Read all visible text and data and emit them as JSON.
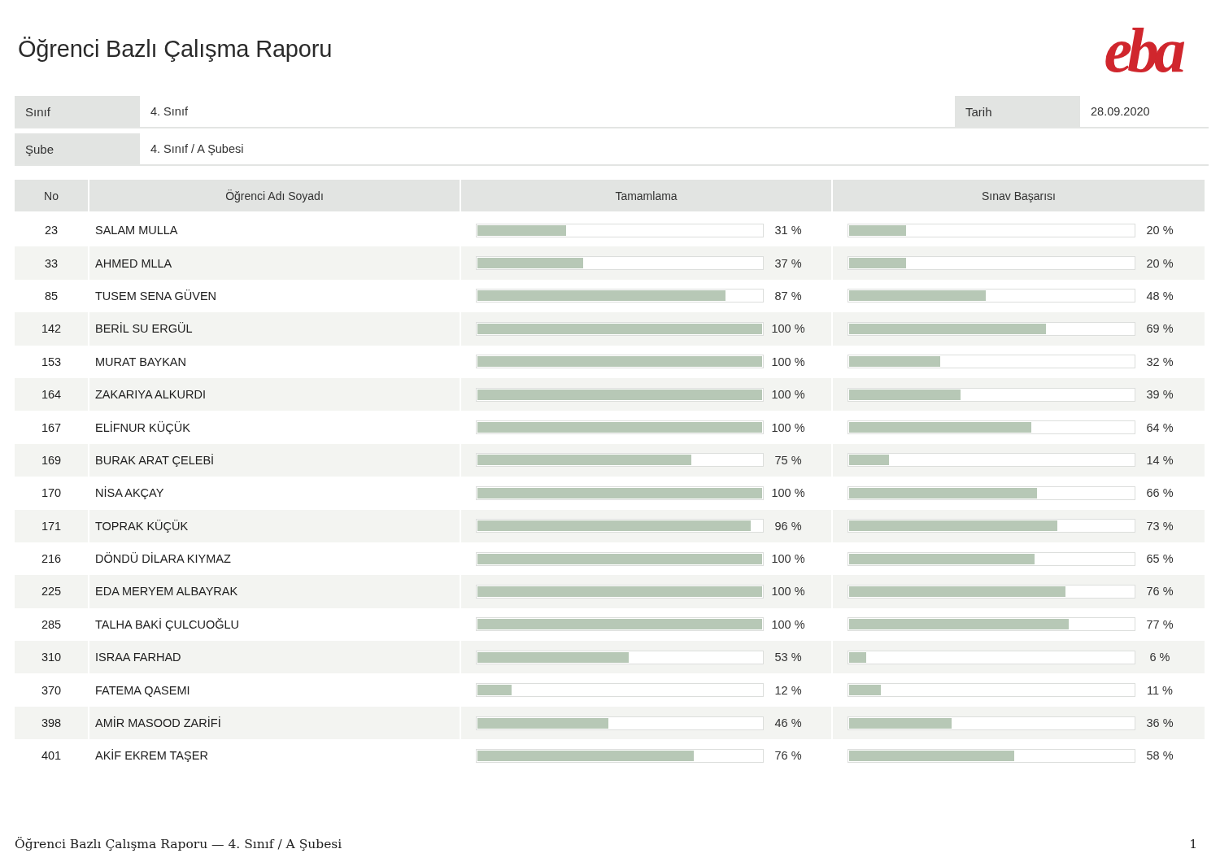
{
  "title": "Öğrenci Bazlı Çalışma Raporu",
  "logo": "eba",
  "info": [
    {
      "label": "Sınıf",
      "value": "4. Sınıf",
      "extra_label": "Tarih",
      "extra_value": "28.09.2020"
    },
    {
      "label": "Şube",
      "value": "4. Sınıf / A Şubesi"
    }
  ],
  "table": {
    "columns": [
      "No",
      "Öğrenci Adı Soyadı",
      "Tamamlama",
      "Sınav Başarısı"
    ],
    "rows": [
      {
        "no": "23",
        "name": "SALAM MULLA",
        "completion": {
          "level": 0.31,
          "reading": "31 %"
        },
        "exam": {
          "level": 0.2,
          "reading": "20 %"
        }
      },
      {
        "no": "33",
        "name": "AHMED MLLA",
        "completion": {
          "level": 0.37,
          "reading": "37 %"
        },
        "exam": {
          "level": 0.2,
          "reading": "20 %"
        }
      },
      {
        "no": "85",
        "name": "TUSEM SENA GÜVEN",
        "completion": {
          "level": 0.87,
          "reading": "87 %"
        },
        "exam": {
          "level": 0.48,
          "reading": "48 %"
        }
      },
      {
        "no": "142",
        "name": "BERİL SU ERGÜL",
        "completion": {
          "level": 1,
          "reading": "100 %"
        },
        "exam": {
          "level": 0.69,
          "reading": "69 %"
        }
      },
      {
        "no": "153",
        "name": "MURAT BAYKAN",
        "completion": {
          "level": 1,
          "reading": "100 %"
        },
        "exam": {
          "level": 0.32,
          "reading": "32 %"
        }
      },
      {
        "no": "164",
        "name": "ZAKARIYA ALKURDI",
        "completion": {
          "level": 1,
          "reading": "100 %"
        },
        "exam": {
          "level": 0.39,
          "reading": "39 %"
        }
      },
      {
        "no": "167",
        "name": "ELİFNUR KÜÇÜK",
        "completion": {
          "level": 1,
          "reading": "100 %"
        },
        "exam": {
          "level": 0.64,
          "reading": "64 %"
        }
      },
      {
        "no": "169",
        "name": "BURAK ARAT ÇELEBİ",
        "completion": {
          "level": 0.75,
          "reading": "75 %"
        },
        "exam": {
          "level": 0.14,
          "reading": "14 %"
        }
      },
      {
        "no": "170",
        "name": "NİSA AKÇAY",
        "completion": {
          "level": 1,
          "reading": "100 %"
        },
        "exam": {
          "level": 0.66,
          "reading": "66 %"
        }
      },
      {
        "no": "171",
        "name": "TOPRAK KÜÇÜK",
        "completion": {
          "level": 0.96,
          "reading": "96 %"
        },
        "exam": {
          "level": 0.73,
          "reading": "73 %"
        }
      },
      {
        "no": "216",
        "name": "DÖNDÜ DİLARA KIYMAZ",
        "completion": {
          "level": 1,
          "reading": "100 %"
        },
        "exam": {
          "level": 0.65,
          "reading": "65 %"
        }
      },
      {
        "no": "225",
        "name": "EDA MERYEM ALBAYRAK",
        "completion": {
          "level": 1,
          "reading": "100 %"
        },
        "exam": {
          "level": 0.76,
          "reading": "76 %"
        }
      },
      {
        "no": "285",
        "name": "TALHA BAKİ ÇULCUOĞLU",
        "completion": {
          "level": 1,
          "reading": "100 %"
        },
        "exam": {
          "level": 0.77,
          "reading": "77 %"
        }
      },
      {
        "no": "310",
        "name": "ISRAA FARHAD",
        "completion": {
          "level": 0.53,
          "reading": "53 %"
        },
        "exam": {
          "level": 0.06,
          "reading": "6 %"
        }
      },
      {
        "no": "370",
        "name": "FATEMA QASEMI",
        "completion": {
          "level": 0.12,
          "reading": "12 %"
        },
        "exam": {
          "level": 0.11,
          "reading": "11 %"
        }
      },
      {
        "no": "398",
        "name": "AMİR MASOOD ZARİFİ",
        "completion": {
          "level": 0.46,
          "reading": "46 %"
        },
        "exam": {
          "level": 0.36,
          "reading": "36 %"
        }
      },
      {
        "no": "401",
        "name": "AKİF EKREM TAŞER",
        "completion": {
          "level": 0.76,
          "reading": "76 %"
        },
        "exam": {
          "level": 0.58,
          "reading": "58 %"
        }
      }
    ]
  },
  "footer": {
    "text": "Öğrenci Bazlı Çalışma Raporu — 4. Sınıf / A Şubesi",
    "page": "1"
  }
}
